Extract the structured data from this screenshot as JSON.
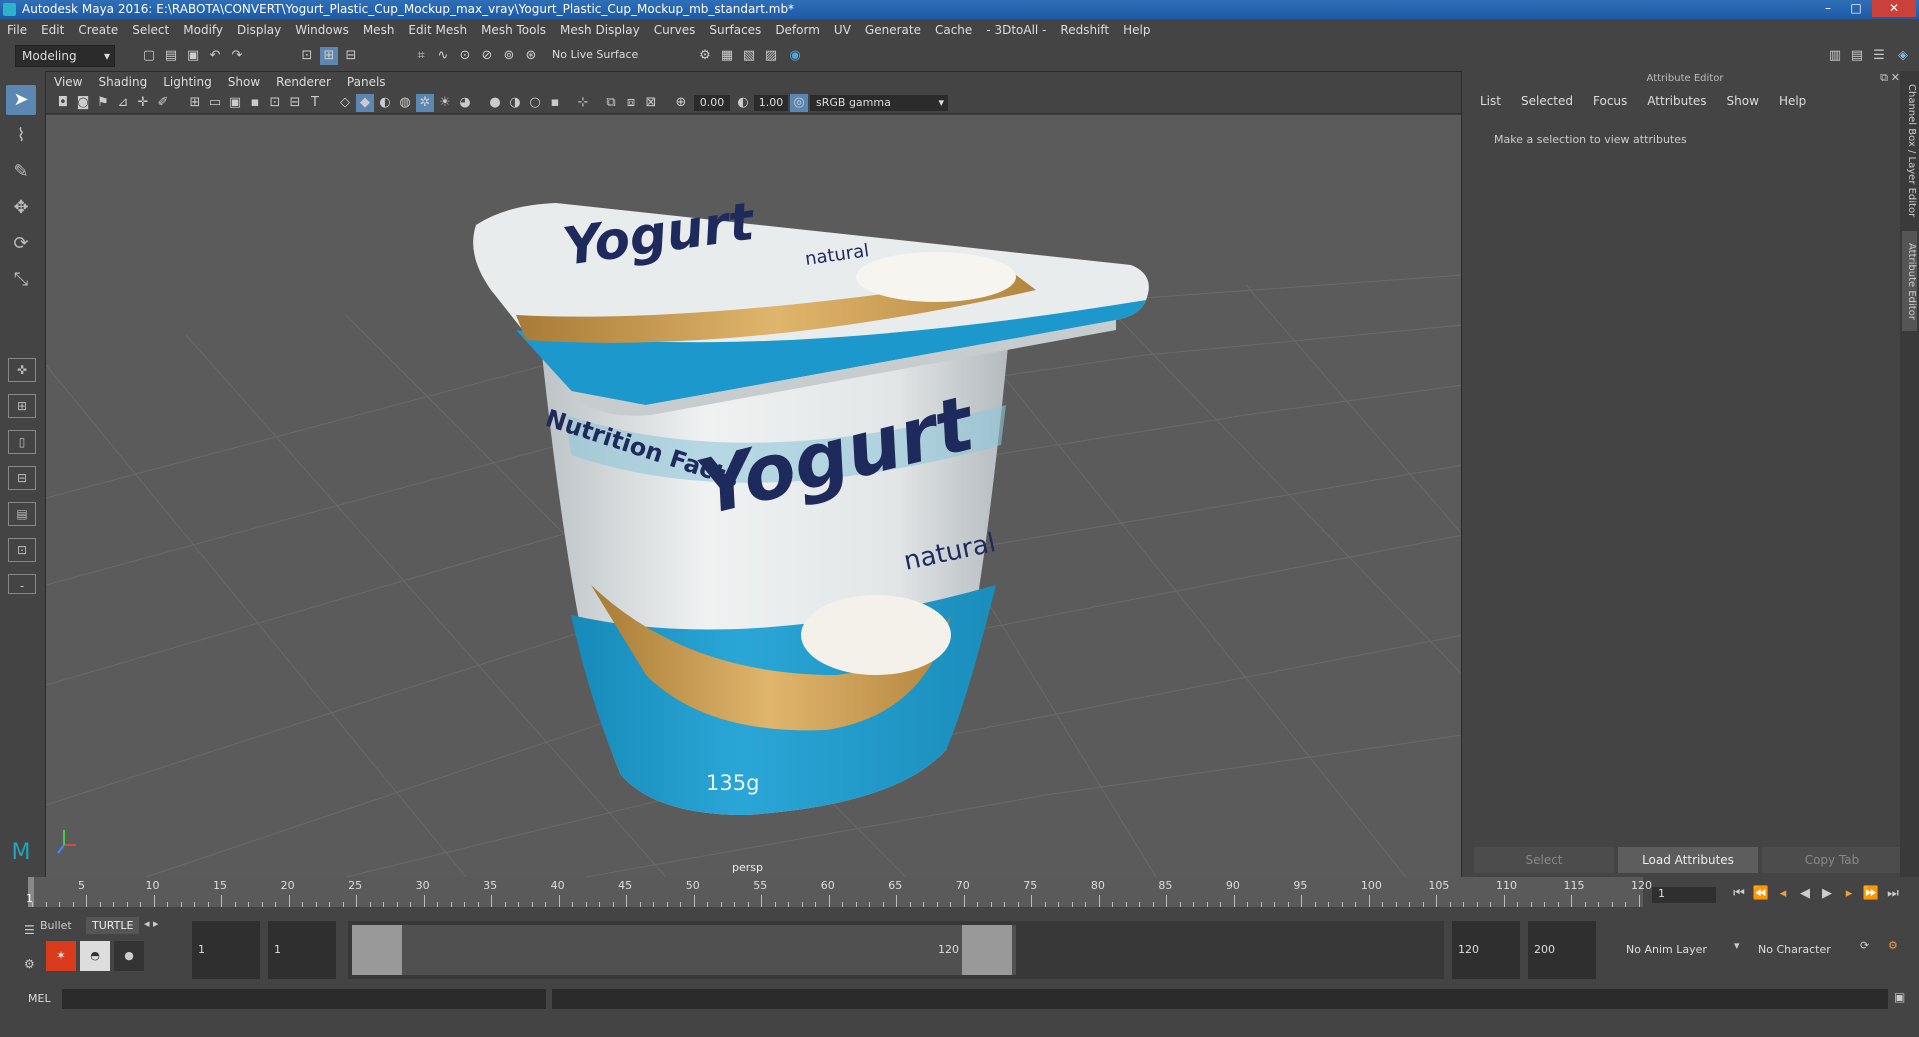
{
  "window": {
    "title": "Autodesk Maya 2016: E:\\RABOTA\\CONVERT\\Yogurt_Plastic_Cup_Mockup_max_vray\\Yogurt_Plastic_Cup_Mockup_mb_standart.mb*",
    "minimize": "–",
    "maximize": "□",
    "close": "✕"
  },
  "menubar": [
    "File",
    "Edit",
    "Create",
    "Select",
    "Modify",
    "Display",
    "Windows",
    "Mesh",
    "Edit Mesh",
    "Mesh Tools",
    "Mesh Display",
    "Curves",
    "Surfaces",
    "Deform",
    "UV",
    "Generate",
    "Cache",
    "- 3DtoAll -",
    "Redshift",
    "Help"
  ],
  "statusline": {
    "mode": "Modeling",
    "live_surface": "No Live Surface"
  },
  "viewport": {
    "menu": [
      "View",
      "Shading",
      "Lighting",
      "Show",
      "Renderer",
      "Panels"
    ],
    "exposure": "0.00",
    "gamma": "1.00",
    "colorspace": "sRGB gamma",
    "camera_label": "persp",
    "model": {
      "brand_lid": "Yogurt",
      "sub_lid": "natural",
      "brand_body": "Yogurt",
      "sub_body": "natural",
      "nutrition": "Nutrition Facts",
      "weight": "135g"
    }
  },
  "attribute_editor": {
    "title": "Attribute Editor",
    "menu": [
      "List",
      "Selected",
      "Focus",
      "Attributes",
      "Show",
      "Help"
    ],
    "message": "Make a selection to view attributes",
    "buttons": {
      "select": "Select",
      "load": "Load Attributes",
      "copy": "Copy Tab"
    },
    "side_tabs": [
      "Channel Box / Layer Editor",
      "Attribute Editor"
    ]
  },
  "timeline": {
    "ticks": [
      "1",
      "5",
      "10",
      "15",
      "20",
      "25",
      "30",
      "35",
      "40",
      "45",
      "50",
      "55",
      "60",
      "65",
      "70",
      "75",
      "80",
      "85",
      "90",
      "95",
      "100",
      "105",
      "110",
      "115",
      "120"
    ],
    "current_frame": "1",
    "current_frame_field": "1"
  },
  "range": {
    "shelf_tabs": [
      "Bullet",
      "TURTLE"
    ],
    "start_frame": "1",
    "playback_start": "1",
    "range_start_label": "1",
    "range_end_label": "120",
    "playback_end": "120",
    "end_frame": "200",
    "anim_layer": "No Anim Layer",
    "character_set": "No Character Set"
  },
  "commandline": {
    "label": "MEL"
  }
}
